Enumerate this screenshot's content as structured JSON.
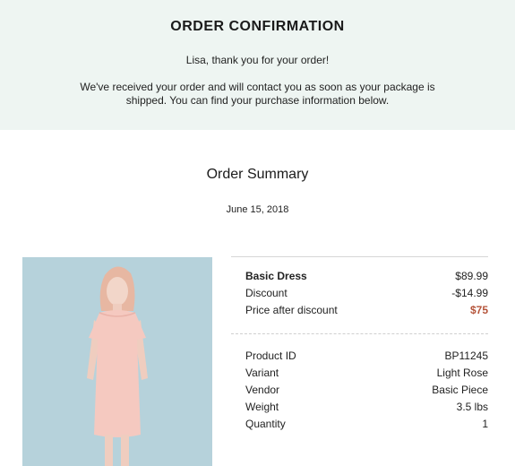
{
  "header": {
    "title": "ORDER CONFIRMATION",
    "thanks": "Lisa, thank you for your order!",
    "message": "We've received your order and will contact you as soon as your package is shipped. You can find your purchase information below."
  },
  "summary": {
    "title": "Order Summary",
    "date": "June 15, 2018"
  },
  "pricing": {
    "product_name": "Basic Dress",
    "product_price": "$89.99",
    "discount_label": "Discount",
    "discount_value": "-$14.99",
    "final_label": "Price after discount",
    "final_value": "$75"
  },
  "details": {
    "product_id_label": "Product ID",
    "product_id": "BP11245",
    "variant_label": "Variant",
    "variant": "Light Rose",
    "vendor_label": "Vendor",
    "vendor": "Basic Piece",
    "weight_label": "Weight",
    "weight": "3.5 lbs",
    "quantity_label": "Quantity",
    "quantity": "1"
  },
  "colors": {
    "header_bg": "#eef5f2",
    "accent": "#b5543a",
    "image_bg": "#b6d2db"
  }
}
